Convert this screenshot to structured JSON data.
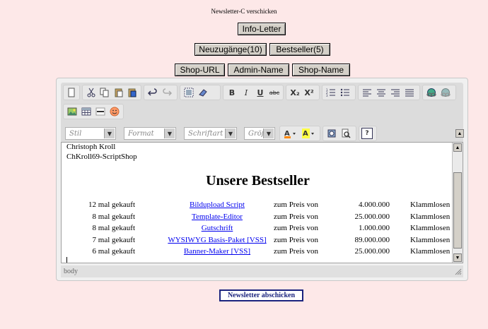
{
  "page_title": "Newsletter-C verschicken",
  "buttons": {
    "info_letter": "Info-Letter",
    "neuzugaenge": "Neuzugänge(10)",
    "bestseller": "Bestseller(5)",
    "shop_url": "Shop-URL",
    "admin_name": "Admin-Name",
    "shop_name": "Shop-Name"
  },
  "toolbar": {
    "combos": {
      "stil": "Stil",
      "format": "Format",
      "schriftart": "Schriftart",
      "groesse": "Größ"
    },
    "bold": "B",
    "italic": "I",
    "underline": "U",
    "strike": "abc",
    "subscript": "X₂",
    "superscript": "X²",
    "help": "?"
  },
  "content": {
    "line1": "Christoph Kroll",
    "line2": "ChKroll69-ScriptShop",
    "heading": "Unsere Bestseller",
    "rows": [
      {
        "count": "12 mal gekauft",
        "product": "Bildupload Script",
        "price_label": "zum Preis von",
        "price": "4.000.000",
        "currency": "Klammlosen"
      },
      {
        "count": "8 mal gekauft",
        "product": "Template-Editor",
        "price_label": "zum Preis von",
        "price": "25.000.000",
        "currency": "Klammlosen"
      },
      {
        "count": "8 mal gekauft",
        "product": "Gutschrift",
        "price_label": "zum Preis von",
        "price": "1.000.000",
        "currency": "Klammlosen"
      },
      {
        "count": "7 mal gekauft",
        "product": "WYSIWYG Basis-Paket [VSS]",
        "price_label": "zum Preis von",
        "price": "89.000.000",
        "currency": "Klammlosen"
      },
      {
        "count": "6 mal gekauft",
        "product": "Banner-Maker [VSS]",
        "price_label": "zum Preis von",
        "price": "25.000.000",
        "currency": "Klammlosen"
      }
    ]
  },
  "statusbar": "body",
  "submit_label": "Newsletter abschicken"
}
